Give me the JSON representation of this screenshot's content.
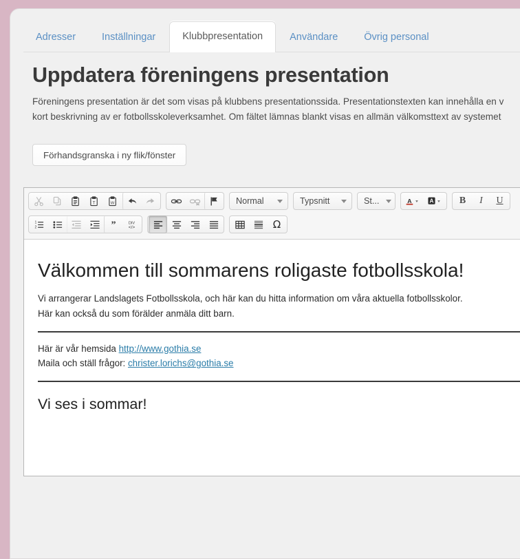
{
  "theme": {
    "page_background": "#d8b6c4",
    "panel_background": "#f0f0f0",
    "tab_link_color": "#5b90c4",
    "active_tab_background": "#ffffff",
    "editor_link_color": "#2a7ca8"
  },
  "tabs": [
    {
      "label": "Adresser",
      "active": false
    },
    {
      "label": "Inställningar",
      "active": false
    },
    {
      "label": "Klubbpresentation",
      "active": true
    },
    {
      "label": "Användare",
      "active": false
    },
    {
      "label": "Övrig personal",
      "active": false
    }
  ],
  "page": {
    "title": "Uppdatera föreningens presentation",
    "lead": "Föreningens presentation är det som visas på klubbens presentationssida. Presentationstexten kan innehålla en v\nkort beskrivning av er fotbollsskoleverksamhet. Om fältet lämnas blankt visas en allmän välkomsttext av systemet"
  },
  "preview_button": {
    "label": "Förhandsgranska i ny flik/fönster"
  },
  "editor": {
    "toolbar_row1": {
      "group_clipboard": [
        {
          "name": "cut-icon",
          "title": "Klipp ut",
          "disabled": true
        },
        {
          "name": "copy-icon",
          "title": "Kopiera",
          "disabled": true
        },
        {
          "name": "paste-icon",
          "title": "Klistra in",
          "disabled": false
        },
        {
          "name": "paste-text-icon",
          "title": "Klistra in som text",
          "disabled": false
        },
        {
          "name": "paste-word-icon",
          "title": "Klistra in från Word",
          "disabled": false
        },
        {
          "name": "undo-icon",
          "title": "Ångra",
          "disabled": false
        },
        {
          "name": "redo-icon",
          "title": "Gör om",
          "disabled": true
        }
      ],
      "group_link": [
        {
          "name": "link-icon",
          "title": "Länk",
          "disabled": false
        },
        {
          "name": "unlink-icon",
          "title": "Ta bort länk",
          "disabled": true
        },
        {
          "name": "anchor-flag-icon",
          "title": "Ankare",
          "disabled": false
        }
      ],
      "selects": [
        {
          "name": "paragraph-format-select",
          "value": "Normal"
        },
        {
          "name": "font-family-select",
          "value": "Typsnitt"
        },
        {
          "name": "font-size-select",
          "value": "St..."
        }
      ],
      "group_color": [
        {
          "name": "text-color-icon",
          "title": "Textfärg",
          "disabled": false
        },
        {
          "name": "background-color-icon",
          "title": "Bakgrundsfärg",
          "disabled": false
        }
      ],
      "group_style": [
        {
          "name": "bold-icon",
          "label": "B",
          "title": "Fet",
          "disabled": false
        },
        {
          "name": "italic-icon",
          "label": "I",
          "title": "Kursiv",
          "disabled": false
        },
        {
          "name": "underline-icon",
          "label": "U",
          "title": "Understruken",
          "disabled": false
        }
      ]
    },
    "toolbar_row2": {
      "group_list": [
        {
          "name": "numbered-list-icon",
          "title": "Numrerad lista",
          "disabled": false
        },
        {
          "name": "bulleted-list-icon",
          "title": "Punktlista",
          "disabled": false
        },
        {
          "name": "outdent-icon",
          "title": "Minska indrag",
          "disabled": true
        },
        {
          "name": "indent-icon",
          "title": "Öka indrag",
          "disabled": false
        },
        {
          "name": "blockquote-icon",
          "title": "Citat",
          "disabled": false
        },
        {
          "name": "div-container-icon",
          "title": "Skapa DIV-behållare",
          "disabled": false
        }
      ],
      "group_align": [
        {
          "name": "align-left-icon",
          "title": "Vänsterjustera",
          "active": true
        },
        {
          "name": "align-center-icon",
          "title": "Centrera",
          "active": false
        },
        {
          "name": "align-right-icon",
          "title": "Högerjustera",
          "active": false
        },
        {
          "name": "align-justify-icon",
          "title": "Marginaljustera",
          "active": false
        }
      ],
      "group_insert": [
        {
          "name": "table-icon",
          "title": "Tabell",
          "disabled": false
        },
        {
          "name": "horizontal-rule-icon",
          "title": "Horisontell linje",
          "disabled": false
        },
        {
          "name": "special-character-icon",
          "label": "Ω",
          "title": "Specialtecken",
          "disabled": false
        }
      ]
    },
    "content": {
      "heading1": "Välkommen till sommarens roligaste fotbollsskola!",
      "paragraph1_line1": "Vi arrangerar Landslagets Fotbollsskola, och här kan du hitta information om våra aktuella fotbollsskolor.",
      "paragraph1_line2": "Här kan också du som förälder anmäla ditt barn.",
      "paragraph2_line1_prefix": "Här är vår hemsida ",
      "paragraph2_line1_link": "http://www.gothia.se",
      "paragraph2_line2_prefix": "Maila och ställ frågor: ",
      "paragraph2_line2_link": "christer.lorichs@gothia.se",
      "heading2": "Vi ses i sommar!"
    }
  }
}
